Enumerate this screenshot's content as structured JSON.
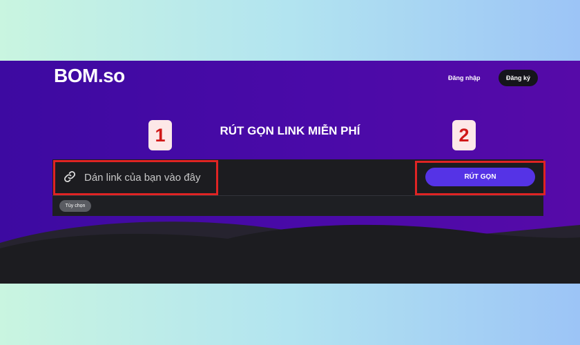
{
  "header": {
    "logo_text": "BOM.so",
    "login_label": "Đăng nhập",
    "signup_label": "Đăng ký"
  },
  "main": {
    "title": "RÚT GỌN LINK MIỄN PHÍ",
    "url_input": {
      "placeholder": "Dán link của bạn vào đây",
      "value": ""
    },
    "shorten_label": "RÚT GỌN",
    "options_label": "Tùy chọn"
  },
  "annotations": {
    "step_1": "1",
    "step_2": "2",
    "highlight_color": "#e02424"
  },
  "colors": {
    "brand_purple": "#4a0aa8",
    "button_accent": "#5533e6",
    "panel_dark": "#1e1f23"
  },
  "icons": {
    "input_icon": "link-icon"
  }
}
